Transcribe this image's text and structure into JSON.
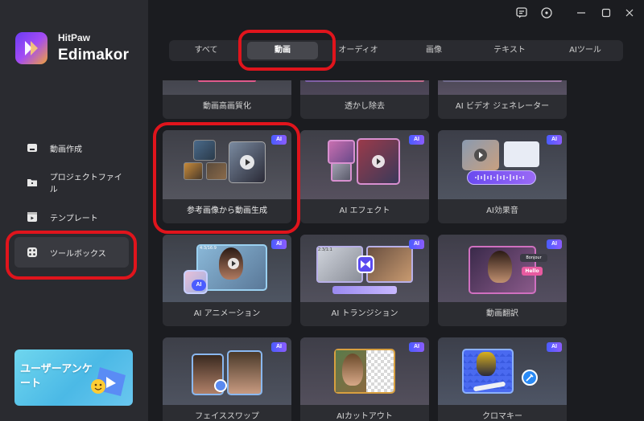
{
  "brand": {
    "line1": "HitPaw",
    "line2": "Edimakor"
  },
  "sidebar": {
    "items": [
      {
        "label": "動画作成",
        "icon": "video-create-icon",
        "active": false
      },
      {
        "label": "プロジェクトファイル",
        "icon": "project-folder-icon",
        "active": false
      },
      {
        "label": "テンプレート",
        "icon": "template-icon",
        "active": false
      },
      {
        "label": "ツールボックス",
        "icon": "toolbox-icon",
        "active": true
      }
    ],
    "promo": {
      "text": "ユーザーアンケート"
    }
  },
  "titlebar": {
    "icons": [
      "feedback-icon",
      "info-icon",
      "minimize-icon",
      "maximize-icon",
      "close-icon"
    ]
  },
  "tabs": [
    {
      "label": "すべて",
      "active": false
    },
    {
      "label": "動画",
      "active": true
    },
    {
      "label": "オーディオ",
      "active": false
    },
    {
      "label": "画像",
      "active": false
    },
    {
      "label": "テキスト",
      "active": false
    },
    {
      "label": "AIツール",
      "active": false
    }
  ],
  "tools": {
    "row1": [
      {
        "label": "動画高画質化",
        "ai": false
      },
      {
        "label": "透かし除去",
        "ai": false
      },
      {
        "label": "AI ビデオ ジェネレーター",
        "ai": false
      }
    ],
    "row2": [
      {
        "label": "参考画像から動画生成",
        "ai": true,
        "badge": "AI"
      },
      {
        "label": "AI エフェクト",
        "ai": true,
        "badge": "AI"
      },
      {
        "label": "AI効果音",
        "ai": true,
        "badge": "AI"
      }
    ],
    "row3": [
      {
        "label": "AI アニメーション",
        "ai": true,
        "badge": "AI"
      },
      {
        "label": "AI トランジション",
        "ai": true,
        "badge": "AI"
      },
      {
        "label": "動画翻訳",
        "ai": true,
        "badge": "AI"
      }
    ],
    "row4": [
      {
        "label": "フェイススワップ",
        "ai": true,
        "badge": "AI"
      },
      {
        "label": "AIカットアウト",
        "ai": true,
        "badge": "AI"
      },
      {
        "label": "クロマキー",
        "ai": true,
        "badge": "AI"
      }
    ]
  },
  "thumb_text": {
    "anim_tag": "4:3/16:9",
    "trans_tag": "2:3/1:1",
    "hello": "Hello",
    "bonjour": "Bonjour",
    "ai": "AI"
  },
  "colors": {
    "accent_red": "#e0141c",
    "ai_badge": "#5a5cff",
    "sidebar_bg": "#2a2b30",
    "page_bg": "#1b1c20"
  }
}
